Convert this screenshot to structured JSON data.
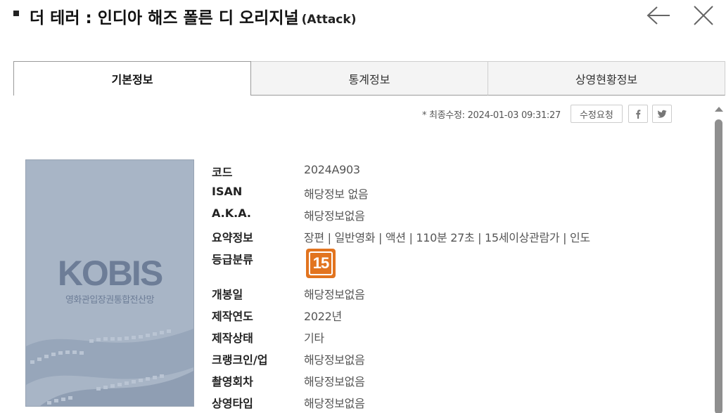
{
  "header": {
    "title": "더 테러 : 인디아 해즈 폴른 디 오리지널",
    "subtitle": "(Attack)",
    "back_icon": "arrow-left-icon",
    "close_icon": "close-icon"
  },
  "tabs": [
    {
      "label": "기본정보",
      "active": true
    },
    {
      "label": "통계정보",
      "active": false
    },
    {
      "label": "상영현황정보",
      "active": false
    }
  ],
  "update": {
    "text": "* 최종수정: 2024-01-03 09:31:27",
    "request_label": "수정요청",
    "facebook_label": "f",
    "twitter_icon": "twitter-icon"
  },
  "poster": {
    "logo": "KOBIS",
    "subtitle": "영화관입장권통합전산망"
  },
  "info": {
    "code": {
      "label": "코드",
      "value": "2024A903"
    },
    "isan": {
      "label": "ISAN",
      "value": "해당정보 없음"
    },
    "aka": {
      "label": "A.K.A.",
      "value": "해당정보없음"
    },
    "summary": {
      "label": "요약정보",
      "value": "장편 | 일반영화 | 액션 | 110분 27초 | 15세이상관람가 | 인도"
    },
    "rating": {
      "label": "등급분류",
      "value": "15"
    },
    "release": {
      "label": "개봉일",
      "value": "해당정보없음"
    },
    "year": {
      "label": "제작연도",
      "value": "2022년"
    },
    "status": {
      "label": "제작상태",
      "value": "기타"
    },
    "crank": {
      "label": "크랭크인/업",
      "value": "해당정보없음"
    },
    "shoot": {
      "label": "촬영회차",
      "value": "해당정보없음"
    },
    "screen_type": {
      "label": "상영타입",
      "value": "해당정보없음"
    }
  },
  "colors": {
    "rating_badge": "#e2741f",
    "poster_bg": "#a8b5c6",
    "poster_text": "#6d7d97"
  }
}
